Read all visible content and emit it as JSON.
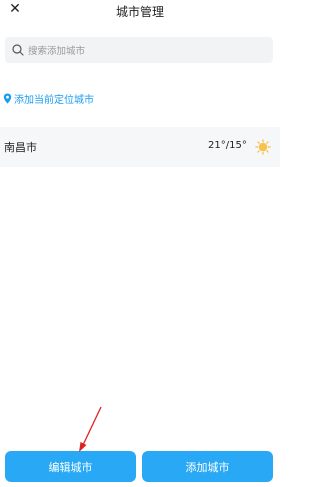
{
  "header": {
    "close_icon": "close-icon",
    "title": "城市管理"
  },
  "search": {
    "icon": "search-icon",
    "placeholder": "搜索添加城市"
  },
  "locate": {
    "icon": "location-pin-icon",
    "label": "添加当前定位城市",
    "color": "#1a9df0"
  },
  "cities": [
    {
      "name": "南昌市",
      "temperature": "21°/15°",
      "weather_icon": "sun-icon"
    }
  ],
  "footer": {
    "edit_label": "编辑城市",
    "add_label": "添加城市",
    "button_color": "#29a9f5"
  },
  "annotation": {
    "arrow_color": "#e02020"
  }
}
